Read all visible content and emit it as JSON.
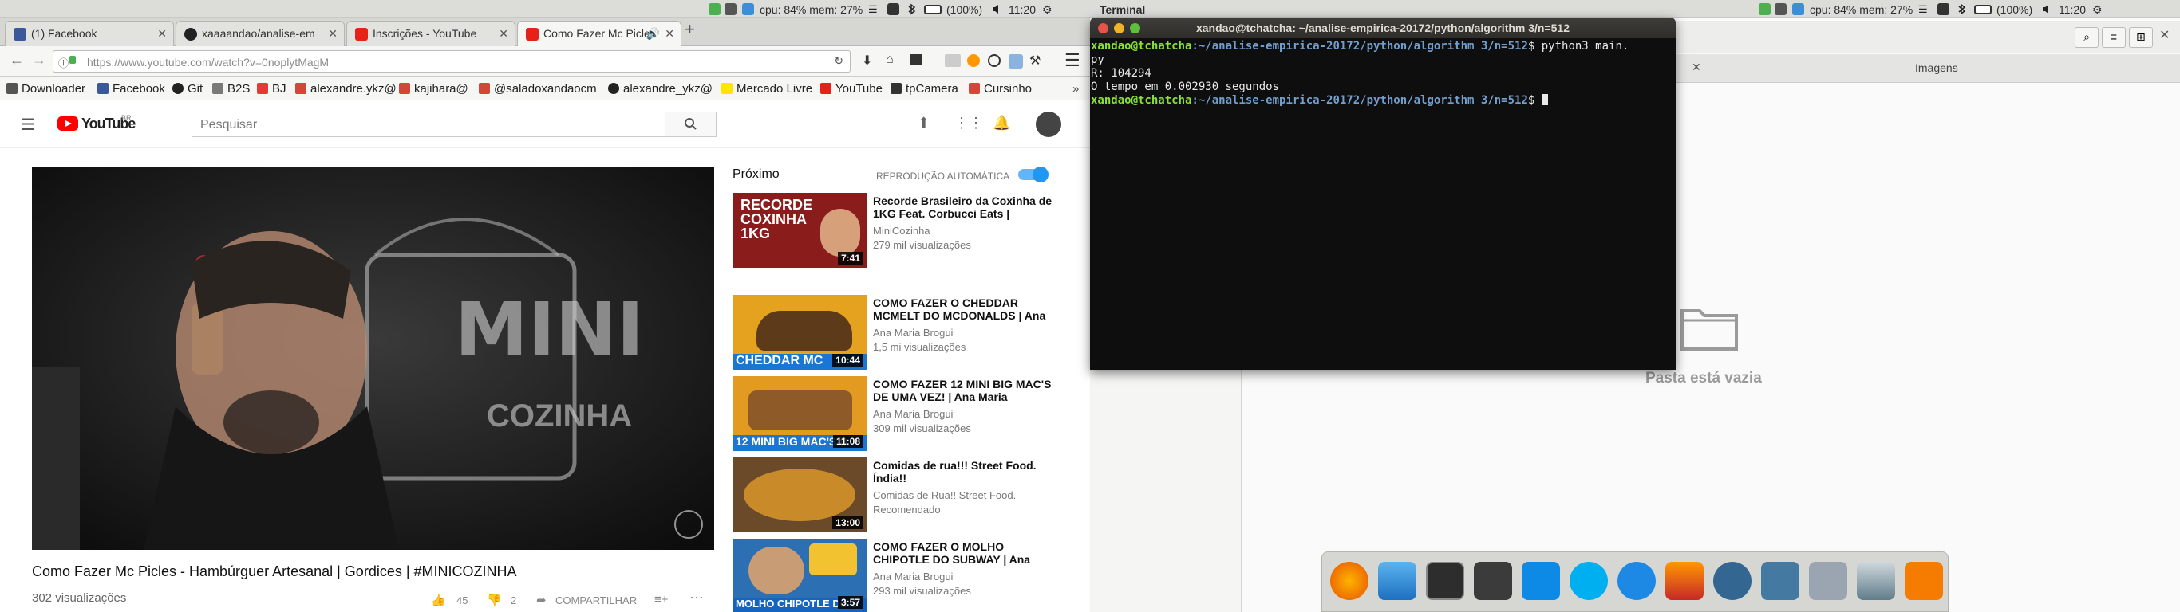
{
  "tray": {
    "cpu": "cpu: 84% mem: 27%",
    "battery": "(100%)",
    "time": "11:20",
    "app": "Terminal"
  },
  "tabs": [
    {
      "label": "(1) Facebook"
    },
    {
      "label": "xaaaandao/analise-em"
    },
    {
      "label": "Inscrições - YouTube"
    },
    {
      "label": "Como Fazer Mc Picle"
    }
  ],
  "url": "https://www.youtube.com/watch?v=0noplytMagM",
  "bookmarks": [
    "Downloader",
    "Facebook",
    "Git",
    "B2S",
    "BJ",
    "alexandre.ykz@",
    "kajihara@",
    "@saladoxandaocm",
    "alexandre_ykz@",
    "Mercado Livre",
    "YouTube",
    "tpCamera",
    "Cursinho"
  ],
  "youtube": {
    "logo": "YouTube",
    "logo_sup": "BR",
    "search_placeholder": "Pesquisar",
    "video_title": "Como Fazer Mc Picles - Hambúrguer Artesanal | Gordices | #MINICOZINHA",
    "views": "302 visualizações",
    "likes": "45",
    "dislikes": "2",
    "share": "COMPARTILHAR",
    "next_label": "Próximo",
    "autoplay_label": "REPRODUÇÃO AUTOMÁTICA",
    "brand_mini": "MINI",
    "brand_cozinha": "COZINHA",
    "suggestions": [
      {
        "title": "Recorde Brasileiro da Coxinha de 1KG Feat. Corbucci Eats |",
        "channel": "MiniCozinha",
        "views": "279 mil visualizações",
        "duration": "7:41",
        "thumb_text": "RECORDE COXINHA 1KG",
        "thumb_color": "#8a1c1c"
      },
      {
        "title": "COMO FAZER O CHEDDAR MCMELT DO MCDONALDS | Ana",
        "channel": "Ana Maria Brogui",
        "views": "1,5 mi visualizações",
        "duration": "10:44",
        "thumb_text": "CHEDDAR MC",
        "thumb_color": "#e5a21e"
      },
      {
        "title": "COMO FAZER 12 MINI BIG MAC'S DE UMA VEZ! | Ana Maria",
        "channel": "Ana Maria Brogui",
        "views": "309 mil visualizações",
        "duration": "11:08",
        "thumb_text": "12 MINI BIG MAC'S D",
        "thumb_color": "#e39a20"
      },
      {
        "title": "Comidas de rua!!! Street Food. Índia!!",
        "channel": "Comidas de Rua!! Street Food.",
        "views": "Recomendado",
        "duration": "13:00",
        "thumb_text": "",
        "thumb_color": "#6b4a2a"
      },
      {
        "title": "COMO FAZER O MOLHO CHIPOTLE DO SUBWAY | Ana",
        "channel": "Ana Maria Brogui",
        "views": "293 mil visualizações",
        "duration": "3:57",
        "thumb_text": "MOLHO CHIPOTLE DO S",
        "thumb_color": "#2d6fb3"
      }
    ]
  },
  "terminal": {
    "title": "xandao@tchatcha: ~/analise-empirica-20172/python/algorithm 3/n=512",
    "user": "xandao@tchatcha",
    "path": ":~/analise-empirica-20172/python/algorithm 3/n=512",
    "cmd1": "$ python3 main.",
    "cmd1b": "py",
    "out1": "R: 104294",
    "out2": "O tempo em 0.002930 segundos",
    "prompt_end": "$ "
  },
  "files": {
    "tab_label": "Imagens",
    "empty": "Pasta está vazia"
  },
  "colors": {
    "yt_red": "#ff0000",
    "term_user": "#8ae234",
    "term_path": "#729fcf",
    "autoplay": "#2196f3"
  }
}
